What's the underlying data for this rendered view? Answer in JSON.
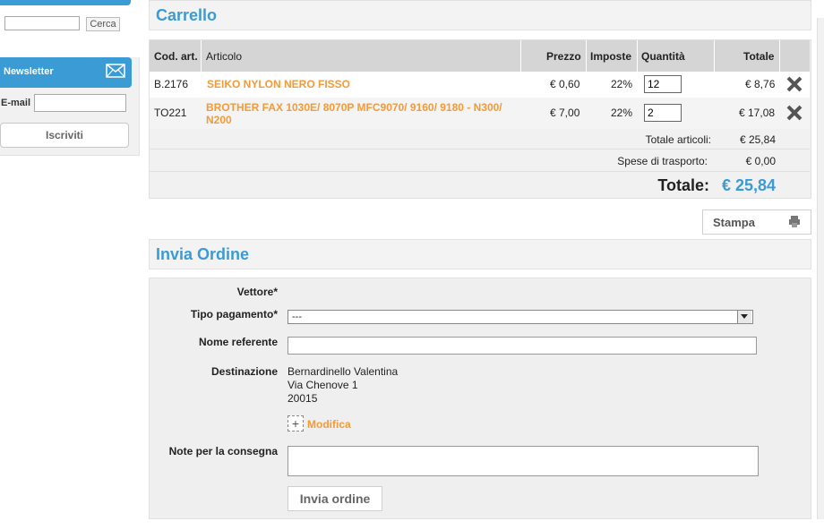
{
  "sidebar": {
    "search_button": "Cerca",
    "newsletter_title": "Newsletter",
    "email_label": "E-mail",
    "subscribe_button": "Iscriviti"
  },
  "cart": {
    "title": "Carrello",
    "headers": {
      "code": "Cod. art.",
      "article": "Articolo",
      "price": "Prezzo",
      "tax": "Imposte",
      "qty": "Quantità",
      "total": "Totale"
    },
    "rows": [
      {
        "code": "B.2176",
        "name": "SEIKO NYLON NERO FISSO",
        "name2": "",
        "price": "€ 0,60",
        "tax": "22%",
        "qty": "12",
        "total": "€ 8,76"
      },
      {
        "code": "TO221",
        "name": "BROTHER FAX 1030E/ 8070P MFC9070/ 9160/ 9180 - N300/",
        "name2": "N200",
        "price": "€ 7,00",
        "tax": "22%",
        "qty": "2",
        "total": "€ 17,08"
      }
    ],
    "items_total_label": "Totale articoli:",
    "items_total": "€ 25,84",
    "shipping_label": "Spese di trasporto:",
    "shipping": "€ 0,00",
    "grand_label": "Totale:",
    "grand_total": "€ 25,84",
    "print_button": "Stampa"
  },
  "order": {
    "title": "Invia Ordine",
    "carrier_label": "Vettore*",
    "payment_label": "Tipo pagamento*",
    "payment_value": "---",
    "contact_label": "Nome referente",
    "destination_label": "Destinazione",
    "destination_lines": [
      "Bernardinello Valentina",
      "Via Chenove 1",
      "20015"
    ],
    "edit_link": "Modifica",
    "notes_label": "Note per la consegna",
    "submit_button": "Invia ordine"
  },
  "colors": {
    "accent": "#3a9bd5",
    "link": "#f39a3a"
  }
}
